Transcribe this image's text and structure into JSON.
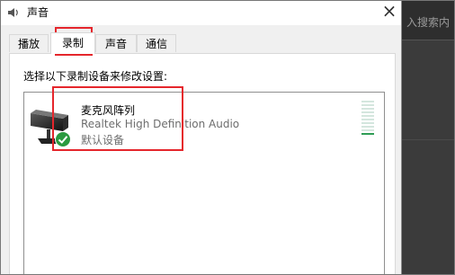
{
  "background_app": {
    "search_fragment": "入搜索内"
  },
  "dialog": {
    "title": "声音",
    "close_glyph": "×",
    "tabs": [
      {
        "label": "播放",
        "active": false
      },
      {
        "label": "录制",
        "active": true
      },
      {
        "label": "声音",
        "active": false
      },
      {
        "label": "通信",
        "active": false
      }
    ],
    "instruction": "选择以下录制设备来修改设置:",
    "devices": [
      {
        "name": "麦克风阵列",
        "driver": "Realtek High Definition Audio",
        "status": "默认设备",
        "icon": "microphone-array-icon",
        "badge": "default-device-check-icon",
        "level_fraction": 0.1
      }
    ]
  },
  "colors": {
    "highlight": "#e5262c",
    "check_green": "#2a9a3f",
    "meter_on": "#2f9d55",
    "meter_off": "#d4e6de"
  }
}
